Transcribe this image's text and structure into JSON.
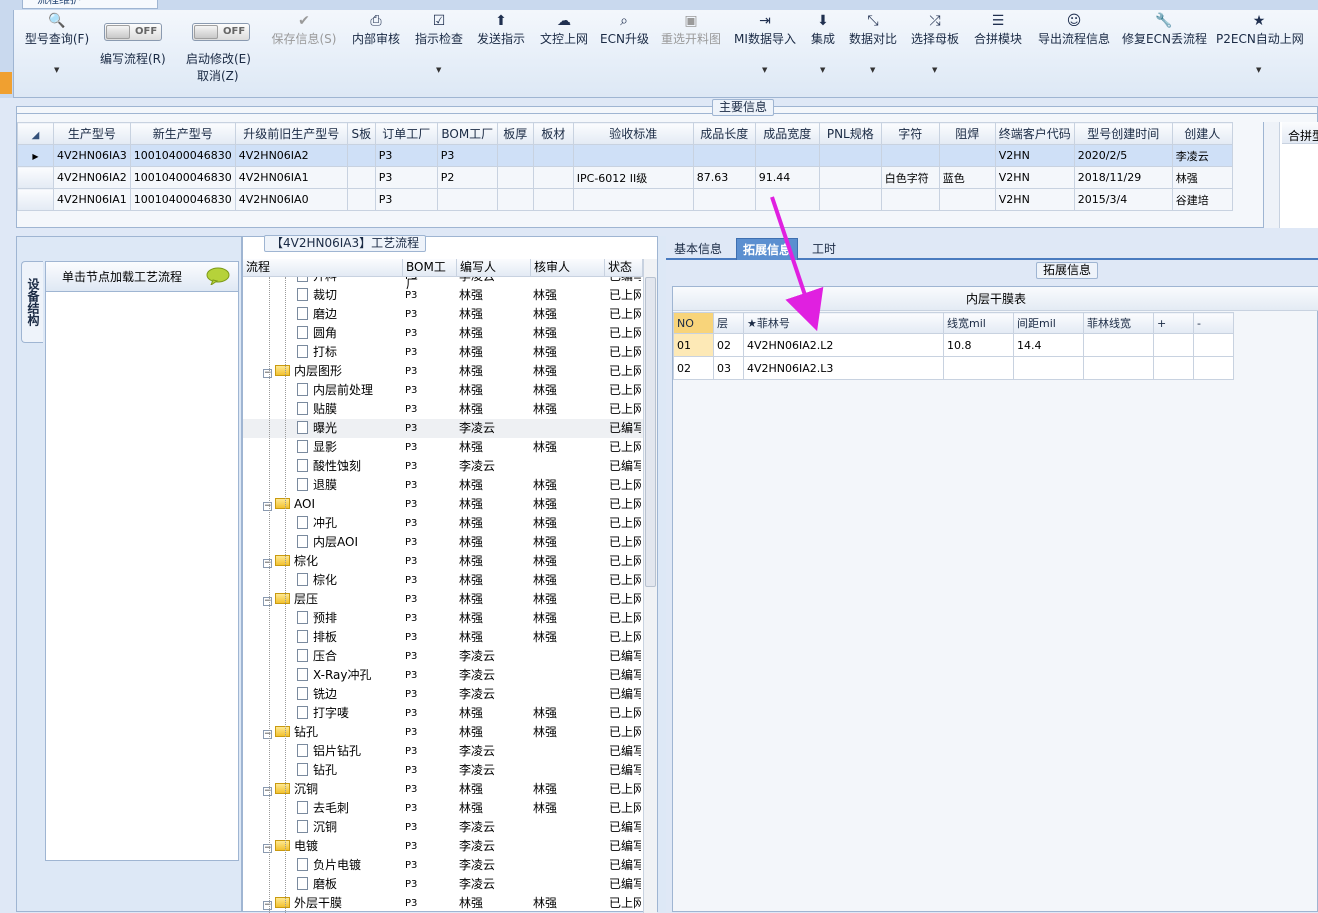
{
  "window": {
    "tab_title": "流程维护"
  },
  "toolbar": {
    "buttons": [
      {
        "label": "型号查询(F)",
        "icon": "search-icon",
        "dropdown": true
      },
      {
        "label": "保存信息(S)",
        "icon": "check-icon",
        "disabled": true
      },
      {
        "label": "内部审核",
        "icon": "printer-icon"
      },
      {
        "label": "指示检查",
        "icon": "checkbox-icon",
        "dropdown": true
      },
      {
        "label": "发送指示",
        "icon": "upload-icon"
      },
      {
        "label": "文控上网",
        "icon": "cloud-upload-icon"
      },
      {
        "label": "ECN升级",
        "icon": "binoculars-icon"
      },
      {
        "label": "重选开料图",
        "icon": "image-icon",
        "disabled": true
      },
      {
        "label": "MI数据导入",
        "icon": "import-icon",
        "dropdown": true
      },
      {
        "label": "集成",
        "icon": "download-icon",
        "dropdown": true
      },
      {
        "label": "数据对比",
        "icon": "compress-icon",
        "dropdown": true
      },
      {
        "label": "选择母板",
        "icon": "shuffle-icon",
        "dropdown": true
      },
      {
        "label": "合拼模块",
        "icon": "list-icon"
      },
      {
        "label": "导出流程信息",
        "icon": "smile-icon"
      },
      {
        "label": "修复ECN丢流程",
        "icon": "wrench-icon"
      },
      {
        "label": "P2ECN自动上网",
        "icon": "star-icon",
        "dropdown": true
      }
    ],
    "toggle_write": {
      "state": "OFF",
      "label": "编写流程(R)"
    },
    "toggle_start": {
      "state": "OFF",
      "label1": "启动修改(E)",
      "label2": "取消(Z)"
    }
  },
  "main_info": {
    "title": "主要信息",
    "columns": [
      "生产型号",
      "新生产型号",
      "升级前旧生产型号",
      "S板",
      "订单工厂",
      "BOM工厂",
      "板厚",
      "板材",
      "验收标准",
      "成品长度",
      "成品宽度",
      "PNL规格",
      "字符",
      "阻焊",
      "终端客户代码",
      "型号创建时间",
      "创建人"
    ],
    "rows": [
      [
        "4V2HN06IA3",
        "10010400046830",
        "4V2HN06IA2",
        "",
        "P3",
        "P3",
        "",
        "",
        "",
        "",
        "",
        "",
        "",
        "",
        "V2HN",
        "2020/2/5",
        "李凌云"
      ],
      [
        "4V2HN06IA2",
        "10010400046830",
        "4V2HN06IA1",
        "",
        "P3",
        "P2",
        "",
        "",
        "IPC-6012 II级",
        "87.63",
        "91.44",
        "",
        "白色字符",
        "蓝色",
        "V2HN",
        "2018/11/29",
        "林强"
      ],
      [
        "4V2HN06IA1",
        "10010400046830",
        "4V2HN06IA0",
        "",
        "P3",
        "",
        "",
        "",
        "",
        "",
        "",
        "",
        "",
        "",
        "V2HN",
        "2015/3/4",
        "谷建培"
      ]
    ],
    "right_header": "合拼型号"
  },
  "left_panel": {
    "vertical_tab": "设备结构",
    "hint": "单击节点加载工艺流程"
  },
  "process": {
    "title": "【4V2HN06IA3】工艺流程",
    "columns": [
      "流程",
      "BOM工厂",
      "编写人",
      "核审人",
      "状态"
    ],
    "rows": [
      {
        "name": "开料",
        "level": 2,
        "bom": "P3",
        "writer": "李凌云",
        "reviewer": "",
        "status": "已编写"
      },
      {
        "name": "裁切",
        "level": 2,
        "bom": "P3",
        "writer": "林强",
        "reviewer": "林强",
        "status": "已上网"
      },
      {
        "name": "磨边",
        "level": 2,
        "bom": "P3",
        "writer": "林强",
        "reviewer": "林强",
        "status": "已上网"
      },
      {
        "name": "圆角",
        "level": 2,
        "bom": "P3",
        "writer": "林强",
        "reviewer": "林强",
        "status": "已上网"
      },
      {
        "name": "打标",
        "level": 2,
        "bom": "P3",
        "writer": "林强",
        "reviewer": "林强",
        "status": "已上网"
      },
      {
        "name": "内层图形",
        "level": 1,
        "bom": "P3",
        "writer": "林强",
        "reviewer": "林强",
        "status": "已上网"
      },
      {
        "name": "内层前处理",
        "level": 2,
        "bom": "P3",
        "writer": "林强",
        "reviewer": "林强",
        "status": "已上网"
      },
      {
        "name": "贴膜",
        "level": 2,
        "bom": "P3",
        "writer": "林强",
        "reviewer": "林强",
        "status": "已上网"
      },
      {
        "name": "曝光",
        "level": 2,
        "bom": "P3",
        "writer": "李凌云",
        "reviewer": "",
        "status": "已编写",
        "highlight": true
      },
      {
        "name": "显影",
        "level": 2,
        "bom": "P3",
        "writer": "林强",
        "reviewer": "林强",
        "status": "已上网"
      },
      {
        "name": "酸性蚀刻",
        "level": 2,
        "bom": "P3",
        "writer": "李凌云",
        "reviewer": "",
        "status": "已编写"
      },
      {
        "name": "退膜",
        "level": 2,
        "bom": "P3",
        "writer": "林强",
        "reviewer": "林强",
        "status": "已上网"
      },
      {
        "name": "AOI",
        "level": 1,
        "bom": "P3",
        "writer": "林强",
        "reviewer": "林强",
        "status": "已上网"
      },
      {
        "name": "冲孔",
        "level": 2,
        "bom": "P3",
        "writer": "林强",
        "reviewer": "林强",
        "status": "已上网"
      },
      {
        "name": "内层AOI",
        "level": 2,
        "bom": "P3",
        "writer": "林强",
        "reviewer": "林强",
        "status": "已上网"
      },
      {
        "name": "棕化",
        "level": 1,
        "bom": "P3",
        "writer": "林强",
        "reviewer": "林强",
        "status": "已上网"
      },
      {
        "name": "棕化",
        "level": 2,
        "bom": "P3",
        "writer": "林强",
        "reviewer": "林强",
        "status": "已上网"
      },
      {
        "name": "层压",
        "level": 1,
        "bom": "P3",
        "writer": "林强",
        "reviewer": "林强",
        "status": "已上网"
      },
      {
        "name": "预排",
        "level": 2,
        "bom": "P3",
        "writer": "林强",
        "reviewer": "林强",
        "status": "已上网"
      },
      {
        "name": "排板",
        "level": 2,
        "bom": "P3",
        "writer": "林强",
        "reviewer": "林强",
        "status": "已上网"
      },
      {
        "name": "压合",
        "level": 2,
        "bom": "P3",
        "writer": "李凌云",
        "reviewer": "",
        "status": "已编写"
      },
      {
        "name": "X-Ray冲孔",
        "level": 2,
        "bom": "P3",
        "writer": "李凌云",
        "reviewer": "",
        "status": "已编写"
      },
      {
        "name": "铣边",
        "level": 2,
        "bom": "P3",
        "writer": "李凌云",
        "reviewer": "",
        "status": "已编写"
      },
      {
        "name": "打字唛",
        "level": 2,
        "bom": "P3",
        "writer": "林强",
        "reviewer": "林强",
        "status": "已上网"
      },
      {
        "name": "钻孔",
        "level": 1,
        "bom": "P3",
        "writer": "林强",
        "reviewer": "林强",
        "status": "已上网"
      },
      {
        "name": "铝片钻孔",
        "level": 2,
        "bom": "P3",
        "writer": "李凌云",
        "reviewer": "",
        "status": "已编写"
      },
      {
        "name": "钻孔",
        "level": 2,
        "bom": "P3",
        "writer": "李凌云",
        "reviewer": "",
        "status": "已编写"
      },
      {
        "name": "沉铜",
        "level": 1,
        "bom": "P3",
        "writer": "林强",
        "reviewer": "林强",
        "status": "已上网"
      },
      {
        "name": "去毛刺",
        "level": 2,
        "bom": "P3",
        "writer": "林强",
        "reviewer": "林强",
        "status": "已上网"
      },
      {
        "name": "沉铜",
        "level": 2,
        "bom": "P3",
        "writer": "李凌云",
        "reviewer": "",
        "status": "已编写"
      },
      {
        "name": "电镀",
        "level": 1,
        "bom": "P3",
        "writer": "李凌云",
        "reviewer": "",
        "status": "已编写"
      },
      {
        "name": "负片电镀",
        "level": 2,
        "bom": "P3",
        "writer": "李凌云",
        "reviewer": "",
        "status": "已编写"
      },
      {
        "name": "磨板",
        "level": 2,
        "bom": "P3",
        "writer": "李凌云",
        "reviewer": "",
        "status": "已编写"
      },
      {
        "name": "外层干膜",
        "level": 1,
        "bom": "P3",
        "writer": "林强",
        "reviewer": "林强",
        "status": "已上网"
      }
    ]
  },
  "right_tabs": [
    "基本信息",
    "拓展信息",
    "工时"
  ],
  "extension": {
    "title": "拓展信息",
    "table_title": "内层干膜表",
    "columns": [
      "NO",
      "层",
      "★菲林号",
      "线宽mil",
      "间距mil",
      "菲林线宽",
      "+",
      "-"
    ],
    "rows": [
      [
        "01",
        "02",
        "4V2HN06IA2.L2",
        "10.8",
        "14.4",
        "",
        "",
        ""
      ],
      [
        "02",
        "03",
        "4V2HN06IA2.L3",
        "",
        "",
        "",
        "",
        ""
      ]
    ]
  },
  "colors": {
    "arrow": "#e020e0",
    "active_tab": "#5b8fd0",
    "selected_row": "#cfe0f7"
  }
}
